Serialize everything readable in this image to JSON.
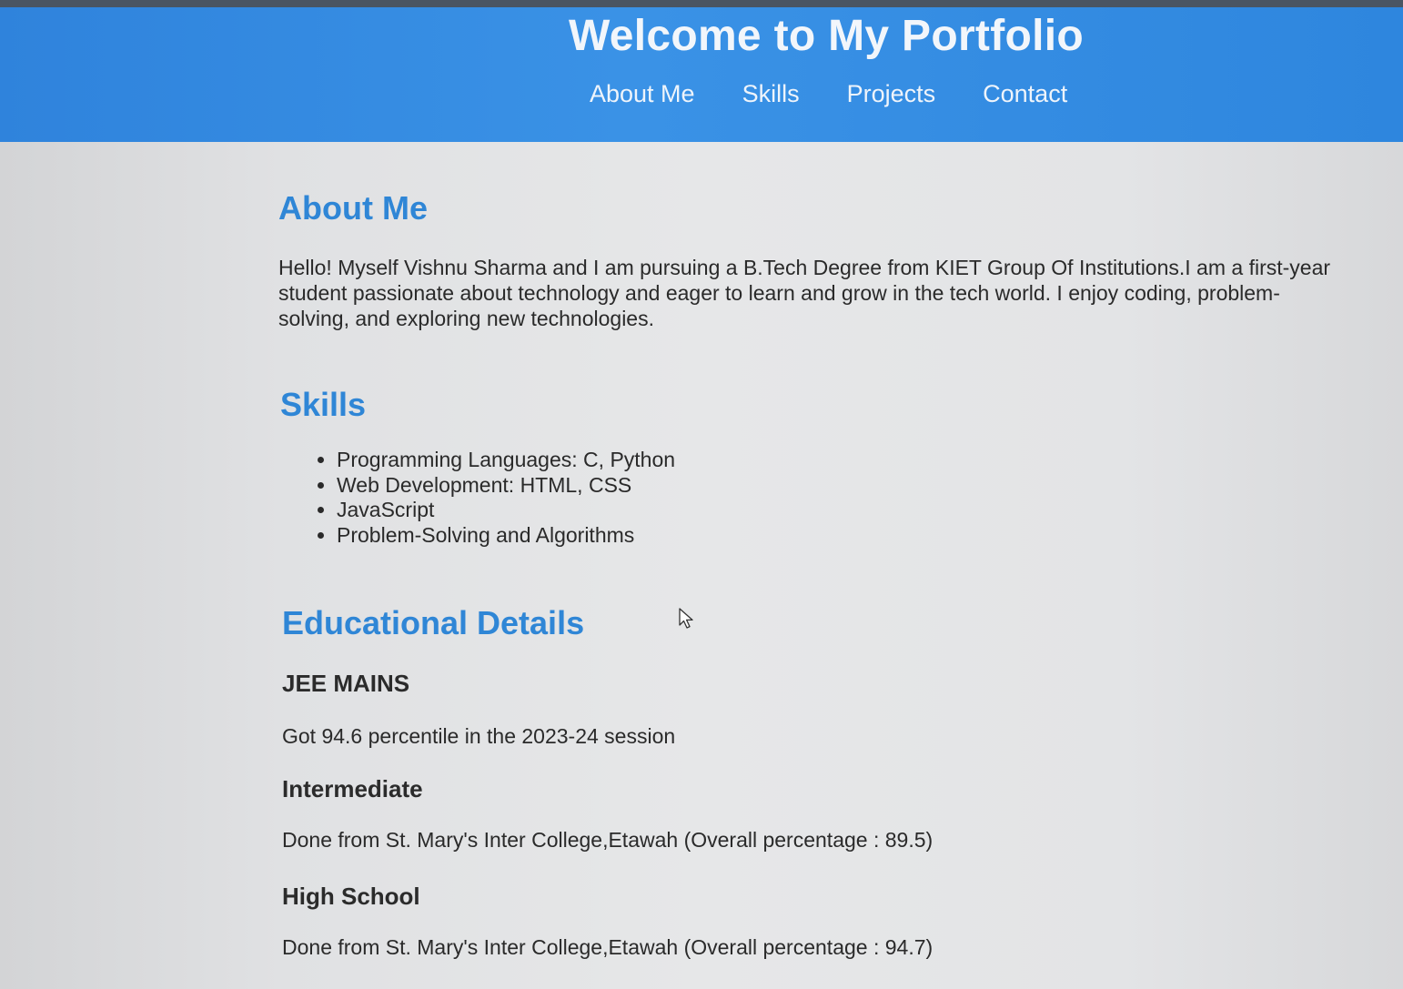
{
  "header": {
    "title": "Welcome to My Portfolio",
    "nav": [
      "About Me",
      "Skills",
      "Projects",
      "Contact"
    ]
  },
  "about": {
    "title": "About Me",
    "text": "Hello! Myself Vishnu Sharma and I am pursuing a B.Tech Degree from KIET Group Of Institutions.I am a first-year student passionate about technology and eager to learn and grow in the tech world. I enjoy coding, problem-solving, and exploring new technologies."
  },
  "skills": {
    "title": "Skills",
    "items": [
      "Programming Languages: C, Python",
      "Web Development: HTML, CSS",
      "JavaScript",
      "Problem-Solving and Algorithms"
    ]
  },
  "education": {
    "title": "Educational Details",
    "entries": [
      {
        "heading": "JEE MAINS",
        "text": "Got 94.6 percentile in the 2023-24 session"
      },
      {
        "heading": "Intermediate",
        "text": "Done from St. Mary's Inter College,Etawah (Overall percentage : 89.5)"
      },
      {
        "heading": "High School",
        "text": "Done from St. Mary's Inter College,Etawah (Overall percentage : 94.7)"
      }
    ]
  },
  "colors": {
    "header_bg": "#3a92e6",
    "section_title": "#2f86d6",
    "page_bg": "#e4e5e7"
  },
  "icons": {
    "cursor": "mouse-pointer-icon"
  }
}
